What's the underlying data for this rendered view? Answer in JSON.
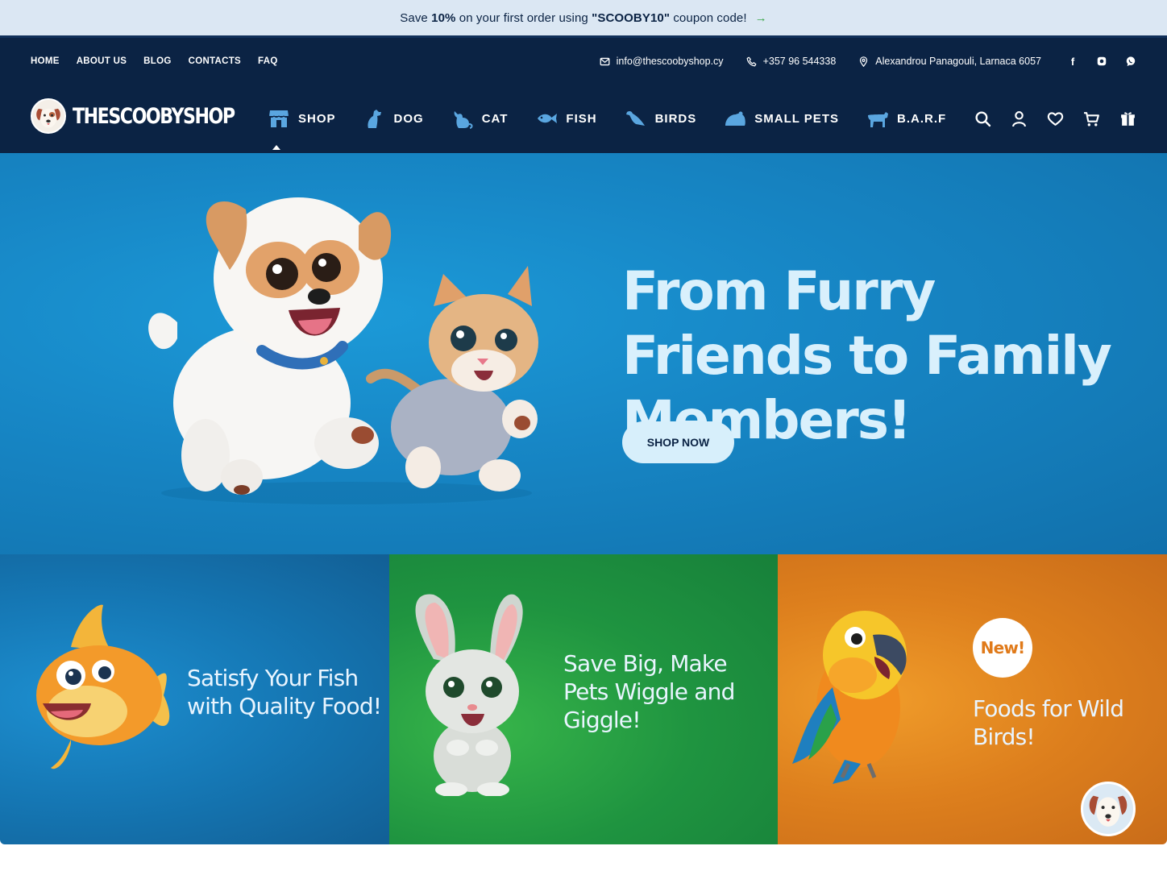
{
  "promo": {
    "prefix": "Save",
    "discount": "10%",
    "middle": "on your first order using",
    "code": "\"SCOOBY10\"",
    "suffix": "coupon code!",
    "arrow": "→"
  },
  "topnav": {
    "items": [
      "HOME",
      "ABOUT US",
      "BLOG",
      "CONTACTS",
      "FAQ"
    ]
  },
  "contact": {
    "email": "info@thescoobyshop.cy",
    "phone": "+357 96 544338",
    "address": "Alexandrou Panagouli, Larnaca 6057"
  },
  "brand": {
    "name": "THESCOOBYSHOP"
  },
  "categories": {
    "items": [
      "SHOP",
      "DOG",
      "CAT",
      "FISH",
      "BIRDS",
      "SMALL PETS",
      "B.A.R.F"
    ]
  },
  "hero": {
    "title": "From Furry Friends to Family Members!",
    "button": "SHOP NOW"
  },
  "cards": {
    "fish": "Satisfy Your Fish with Quality Food!",
    "rabbit": "Save Big, Make Pets Wiggle and Giggle!",
    "birds": "Foods for Wild Birds!",
    "badge": "New!"
  },
  "colors": {
    "navy": "#0b2344",
    "promo_bg": "#dbe7f3",
    "hero_blue": "#1787c6",
    "green": "#1f9440",
    "orange": "#dd7f1d"
  }
}
